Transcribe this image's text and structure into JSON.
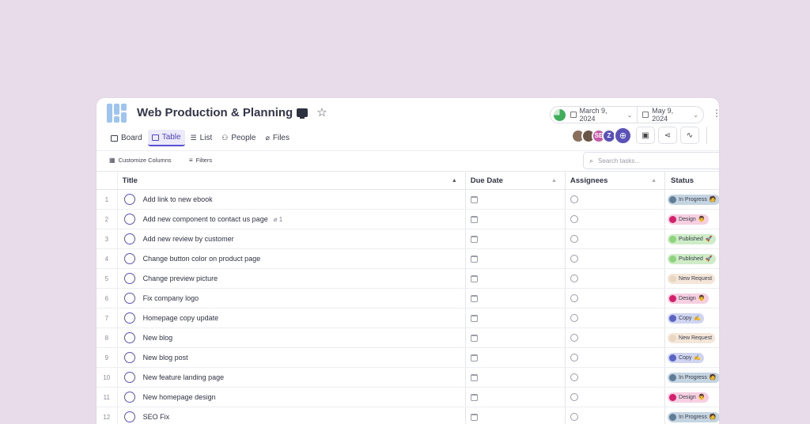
{
  "header": {
    "title": "Web Production & Planning",
    "start_date": "March 9, 2024",
    "end_date": "May 9, 2024",
    "progress": 0.75,
    "avatars": [
      "",
      "",
      "SE",
      "Z"
    ]
  },
  "tabs": [
    {
      "label": "Board"
    },
    {
      "label": "Table",
      "active": true
    },
    {
      "label": "List"
    },
    {
      "label": "People"
    },
    {
      "label": "Files"
    }
  ],
  "toolbar": {
    "customize_label": "Customize Columns",
    "filters_label": "Filters",
    "search_placeholder": "Search tasks..."
  },
  "columns": {
    "title": "Title",
    "due": "Due Date",
    "assignees": "Assignees",
    "status": "Status"
  },
  "status_colors": {
    "In Progress": {
      "bg": "#c5d4e1",
      "dot": "#5f7d96"
    },
    "Design": {
      "bg": "#f6cfe0",
      "dot": "#d51f6a"
    },
    "Published": {
      "bg": "#cdecc7",
      "dot": "#8dd27c"
    },
    "New Request": {
      "bg": "#f4e6d8",
      "dot": "#ead7c2"
    },
    "Copy": {
      "bg": "#cfd5f1",
      "dot": "#5a63c4"
    }
  },
  "rows": [
    {
      "num": "1",
      "title": "Add link to new ebook",
      "status": "In Progress",
      "emoji": "🧑"
    },
    {
      "num": "2",
      "title": "Add new component to contact us page",
      "attachments": "1",
      "status": "Design",
      "emoji": "👨"
    },
    {
      "num": "3",
      "title": "Add new review by customer",
      "status": "Published",
      "emoji": "🚀"
    },
    {
      "num": "4",
      "title": "Change button color on product page",
      "status": "Published",
      "emoji": "🚀"
    },
    {
      "num": "5",
      "title": "Change preview picture",
      "status": "New Request",
      "emoji": ""
    },
    {
      "num": "6",
      "title": "Fix company logo",
      "status": "Design",
      "emoji": "👨"
    },
    {
      "num": "7",
      "title": "Homepage copy update",
      "status": "Copy",
      "emoji": "✍"
    },
    {
      "num": "8",
      "title": "New blog",
      "status": "New Request",
      "emoji": ""
    },
    {
      "num": "9",
      "title": "New blog post",
      "status": "Copy",
      "emoji": "✍"
    },
    {
      "num": "10",
      "title": "New feature landing page",
      "status": "In Progress",
      "emoji": "🧑"
    },
    {
      "num": "11",
      "title": "New homepage design",
      "status": "Design",
      "emoji": "👨"
    },
    {
      "num": "12",
      "title": "SEO Fix",
      "status": "In Progress",
      "emoji": "🧑"
    }
  ]
}
